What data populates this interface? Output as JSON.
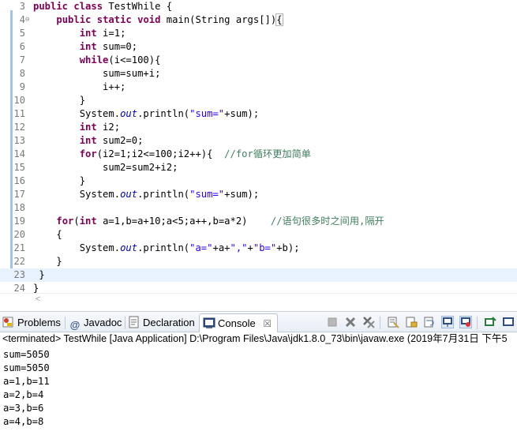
{
  "editor": {
    "lines": [
      {
        "n": "3",
        "html": "<span class='kw'>public</span> <span class='kw'>class</span> TestWhile {"
      },
      {
        "n": "4",
        "fold": "⊖",
        "html": "    <span class='kw'>public</span> <span class='kw'>static</span> <span class='kw'>void</span> main(String args[])<span class='brk'>{</span>"
      },
      {
        "n": "5",
        "html": "        <span class='kw'>int</span> i=1;"
      },
      {
        "n": "6",
        "html": "        <span class='kw'>int</span> sum=0;"
      },
      {
        "n": "7",
        "html": "        <span class='kw'>while</span>(i&lt;=100){"
      },
      {
        "n": "8",
        "html": "            sum=sum+i;"
      },
      {
        "n": "9",
        "html": "            i++;"
      },
      {
        "n": "10",
        "html": "        }"
      },
      {
        "n": "11",
        "html": "        System.<span class='fld'>out</span>.println(<span class='str'>\"sum=\"</span>+sum);"
      },
      {
        "n": "12",
        "html": "        <span class='kw'>int</span> i2;"
      },
      {
        "n": "13",
        "html": "        <span class='kw'>int</span> sum2=0;"
      },
      {
        "n": "14",
        "html": "        <span class='kw'>for</span>(i2=1;i2&lt;=100;i2++){  <span class='cmt'>//for循环更加简单</span>"
      },
      {
        "n": "15",
        "html": "            sum2=sum2+i2;"
      },
      {
        "n": "16",
        "html": "        }"
      },
      {
        "n": "17",
        "html": "        System.<span class='fld'>out</span>.println(<span class='str'>\"sum=\"</span>+sum);"
      },
      {
        "n": "18",
        "html": ""
      },
      {
        "n": "19",
        "html": "    <span class='kw'>for</span>(<span class='kw'>int</span> a=1,b=a+10;a&lt;5;a++,b=a*2)    <span class='cmt'>//语句很多时之间用,隔开</span>"
      },
      {
        "n": "20",
        "html": "    {"
      },
      {
        "n": "21",
        "html": "        System.<span class='fld'>out</span>.println(<span class='str'>\"a=\"</span>+a+<span class='str'>\",\"</span>+<span class='str'>\"b=\"</span>+b);"
      },
      {
        "n": "22",
        "html": "    }"
      },
      {
        "n": "23",
        "current": true,
        "html": " }"
      },
      {
        "n": "24",
        "html": "}"
      }
    ],
    "scroll_arrow": "<"
  },
  "views": {
    "tabs": [
      {
        "id": "problems",
        "label": "Problems",
        "icon": "problems-icon"
      },
      {
        "id": "javadoc",
        "label": "Javadoc",
        "icon": "javadoc-icon"
      },
      {
        "id": "declaration",
        "label": "Declaration",
        "icon": "declaration-icon"
      },
      {
        "id": "console",
        "label": "Console",
        "icon": "console-icon",
        "active": true,
        "close": "☒"
      }
    ]
  },
  "console": {
    "header": "<terminated> TestWhile [Java Application] D:\\Program Files\\Java\\jdk1.8.0_73\\bin\\javaw.exe (2019年7月31日 下午5",
    "output": [
      "sum=5050",
      "sum=5050",
      "a=1,b=11",
      "a=2,b=4",
      "a=3,b=6",
      "a=4,b=8"
    ]
  },
  "colors": {
    "keyword": "#7f0055",
    "string": "#2a00ff",
    "comment": "#3f7f5f",
    "field": "#0000c0",
    "current_line": "#e8f2fe"
  }
}
